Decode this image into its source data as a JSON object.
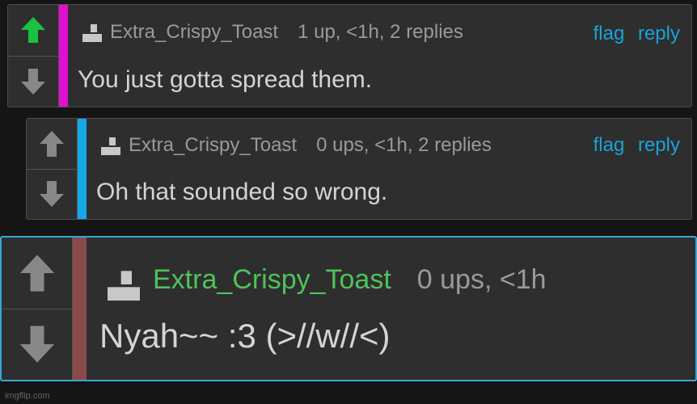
{
  "colors": {
    "background": "#151515",
    "panel": "#2e2e2e",
    "upvote_active": "#19c241",
    "vote_inactive": "#888888",
    "action_link": "#1aa3d9",
    "username_highlight": "#4fc25a"
  },
  "icons": {
    "vote_up": "arrow-up-icon",
    "vote_down": "arrow-down-icon",
    "avatar": "user-avatar-icon"
  },
  "comments": [
    {
      "username": "Extra_Crispy_Toast",
      "stats": "1 up, <1h, 2 replies",
      "flag": "flag",
      "reply": "reply",
      "text": "You just gotta spread them.",
      "upvoted": true,
      "stripe_color": "#e10fd0"
    },
    {
      "username": "Extra_Crispy_Toast",
      "stats": "0 ups, <1h, 2 replies",
      "flag": "flag",
      "reply": "reply",
      "text": "Oh that sounded so wrong.",
      "upvoted": false,
      "stripe_color": "#12a9e6"
    },
    {
      "username": "Extra_Crispy_Toast",
      "stats": "0 ups, <1h",
      "text": "Nyah~~ :3 (>//w//<)",
      "upvoted": false,
      "stripe_color": "#8a4a4a"
    }
  ],
  "watermark": "imgflip.com"
}
